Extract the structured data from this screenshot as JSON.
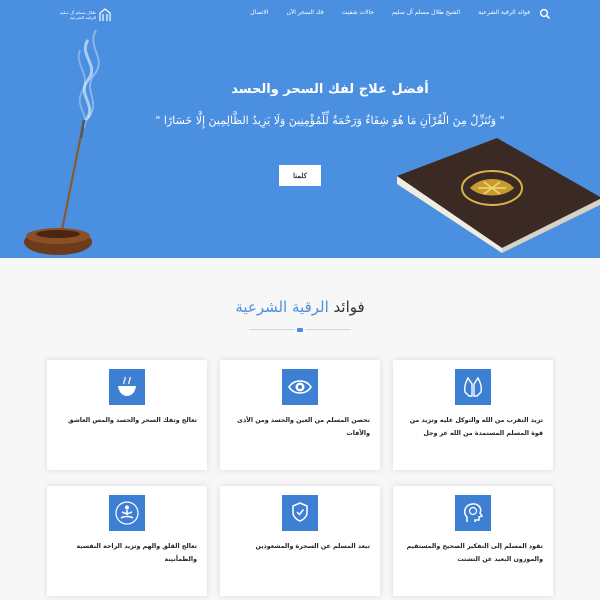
{
  "header": {
    "logo_text": "طلال مسلم آل سليم للرقية الشرعية",
    "nav": [
      "فوائد الرقية الشرعية",
      "الشيخ طلال مسلم آل سليم",
      "حالات شفيت",
      "فك السحر الآن",
      "الاتصال"
    ],
    "search_icon": "search-icon"
  },
  "hero": {
    "title": "أفضل علاج لفك السحر والحسد",
    "verse": "\" وَنُنَزِّلُ مِنَ الْقُرْآنِ مَا هُوَ شِفَاءٌ وَرَحْمَةٌ لِّلْمُؤْمِنِينَ وَلَا يَزِيدُ الظَّالِمِينَ إِلَّا خَسَارًا \"",
    "button_label": "كلمنا"
  },
  "benefits": {
    "title_main": "فوائد",
    "title_accent": "الرقية الشرعية",
    "cards": [
      {
        "icon": "praying-hands-icon",
        "text": "تزيد التقرب من الله والتوكل عليه وتزيد من قوة المسلم المستمدة من الله عز وجل"
      },
      {
        "icon": "eye-icon",
        "text": "تحصن المسلم من العين والحسد ومن الأذى والآفات"
      },
      {
        "icon": "incense-bowl-icon",
        "text": "تعالج وتفك السحر والحسد والمس العاشق"
      },
      {
        "icon": "head-brain-icon",
        "text": "تقود المسلم إلى التفكير الصحيح والمستقيم والموزون البعيد عن التشتت"
      },
      {
        "icon": "hand-protect-icon",
        "text": "تبعد المسلم عن السحرة والمشعوذين"
      },
      {
        "icon": "meditation-icon",
        "text": "تعالج القلق والهم وتزيد الراحة النفسية والطمأنينة"
      }
    ]
  },
  "colors": {
    "accent": "#4a8fe0",
    "icon_bg": "#3d7fd3",
    "background": "#f7f7f7"
  }
}
